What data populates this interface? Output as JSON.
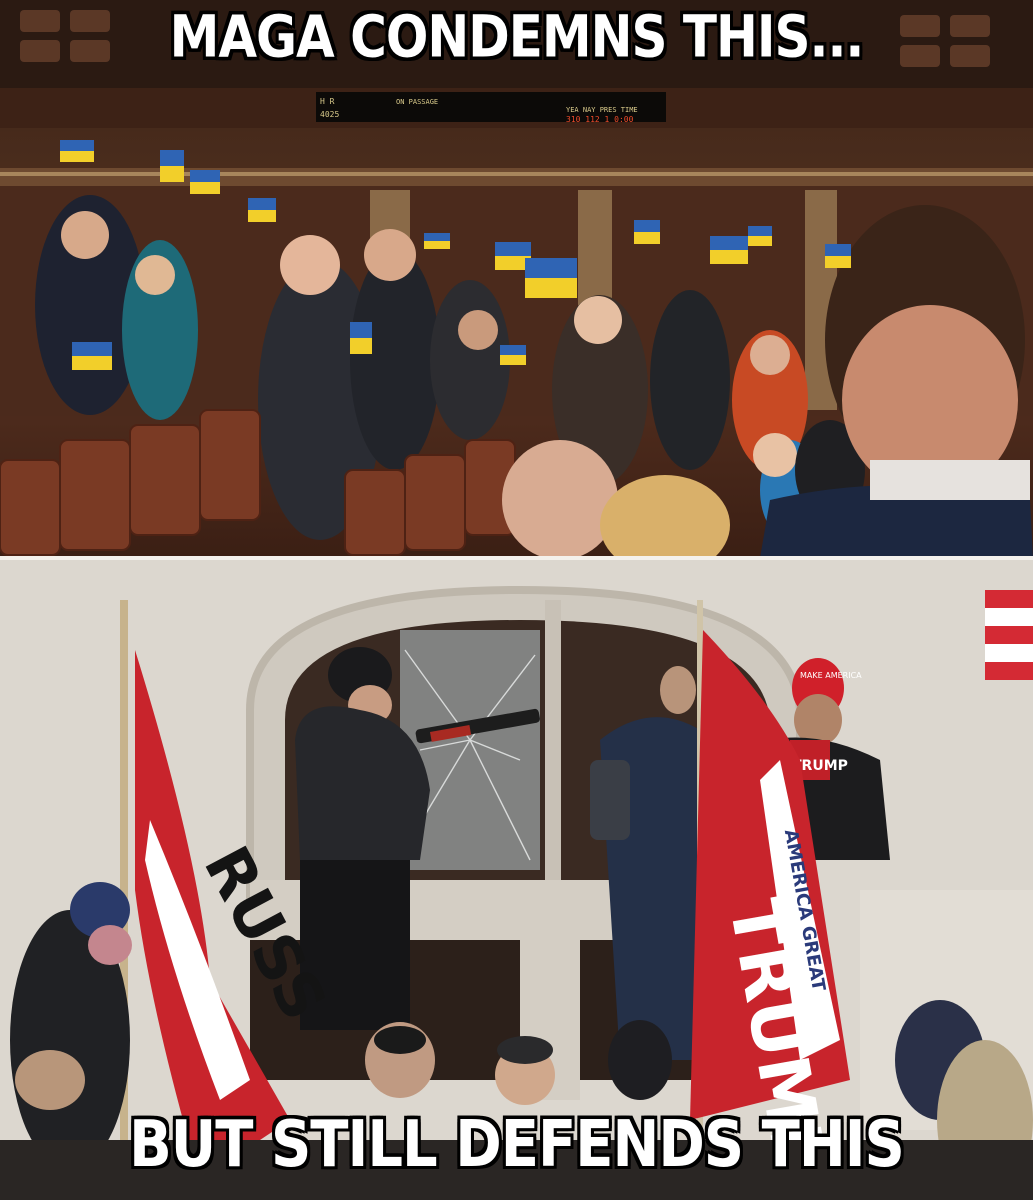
{
  "meme": {
    "top_caption": "MAGA CONDEMNS THIS...",
    "bottom_caption": "BUT STILL DEFENDS THIS"
  },
  "top_photo": {
    "scoreboard": {
      "left_label": "H R",
      "left_number": "4025",
      "passage_label": "ON PASSAGE",
      "headers": "YEA NAY PRES TIME",
      "values": "310 112 1 0:00"
    },
    "colors": {
      "flag_blue": "#2f64b4",
      "flag_yellow": "#f2cf2a",
      "seat": "#7a3a24"
    }
  },
  "bottom_photo": {
    "flag_left_text": "RUSS",
    "flag_center_text": "TRUMP",
    "flag_center_subtext": "AMERICA GREAT",
    "cap_text": "TRUMP",
    "colors": {
      "flag_red": "#c8242c",
      "maga_red": "#d0202a",
      "stone": "#dcd7cf"
    }
  }
}
